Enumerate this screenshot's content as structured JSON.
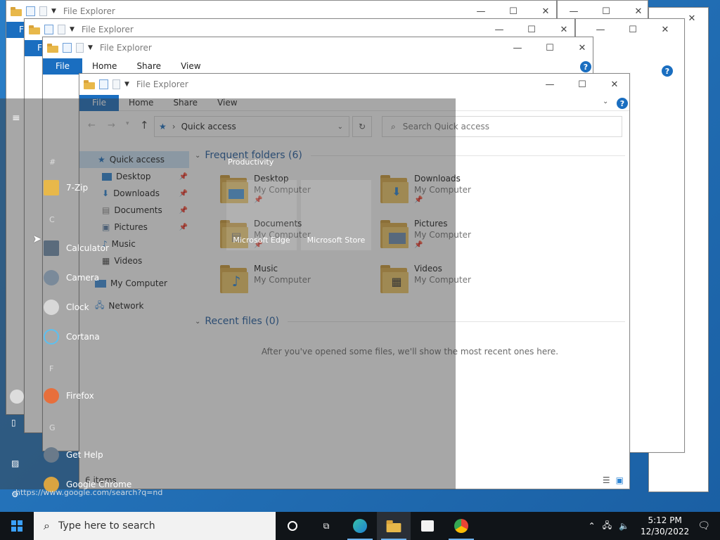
{
  "window": {
    "title": "File Explorer",
    "ribbon": {
      "file": "File",
      "home": "Home",
      "share": "Share",
      "view": "View"
    },
    "help": "?"
  },
  "address": {
    "location": "Quick access",
    "separator": "›"
  },
  "search": {
    "placeholder": "Search Quick access"
  },
  "nav": {
    "quick_access": "Quick access",
    "items": [
      {
        "label": "Desktop",
        "icon": "desktop-icon",
        "pinned": true
      },
      {
        "label": "Downloads",
        "icon": "download-icon",
        "pinned": true
      },
      {
        "label": "Documents",
        "icon": "document-icon",
        "pinned": true
      },
      {
        "label": "Pictures",
        "icon": "picture-icon",
        "pinned": true
      },
      {
        "label": "Music",
        "icon": "music-icon",
        "pinned": false
      },
      {
        "label": "Videos",
        "icon": "video-icon",
        "pinned": false
      }
    ],
    "my_computer": "My Computer",
    "network": "Network"
  },
  "frequent": {
    "header": "Frequent folders (6)",
    "folders": [
      {
        "name": "Desktop",
        "location": "My Computer",
        "pinned": true
      },
      {
        "name": "Downloads",
        "location": "My Computer",
        "pinned": true
      },
      {
        "name": "Documents",
        "location": "My Computer",
        "pinned": true
      },
      {
        "name": "Pictures",
        "location": "My Computer",
        "pinned": true
      },
      {
        "name": "Music",
        "location": "My Computer",
        "pinned": false
      },
      {
        "name": "Videos",
        "location": "My Computer",
        "pinned": false
      }
    ]
  },
  "recent": {
    "header": "Recent files (0)",
    "empty_message": "After you've opened some files, we'll show the most recent ones here."
  },
  "status": {
    "items": "6 items"
  },
  "start_menu": {
    "group_label": "Productivity",
    "tiles": [
      "Microsoft Edge",
      "Microsoft Store"
    ],
    "apps": [
      {
        "label": "7-Zip",
        "icon": "folder-icon"
      },
      {
        "label": "Calculator",
        "icon": "calculator-icon"
      },
      {
        "label": "Camera",
        "icon": "camera-icon"
      },
      {
        "label": "Clock",
        "icon": "clock-icon"
      },
      {
        "label": "Cortana",
        "icon": "cortana-icon"
      },
      {
        "label": "Firefox",
        "icon": "firefox-icon"
      },
      {
        "label": "Get Help",
        "icon": "help-icon"
      },
      {
        "label": "Google Chrome",
        "icon": "chrome-icon"
      }
    ],
    "letters": [
      "#",
      "C",
      "F",
      "G"
    ]
  },
  "url_hint": "https://www.google.com/search?q=nd",
  "taskbar": {
    "search_placeholder": "Type here to search",
    "time": "5:12 PM",
    "date": "12/30/2022"
  },
  "colors": {
    "accent": "#1a6ec0",
    "taskbar": "#101418",
    "folder": "#f0c866"
  }
}
